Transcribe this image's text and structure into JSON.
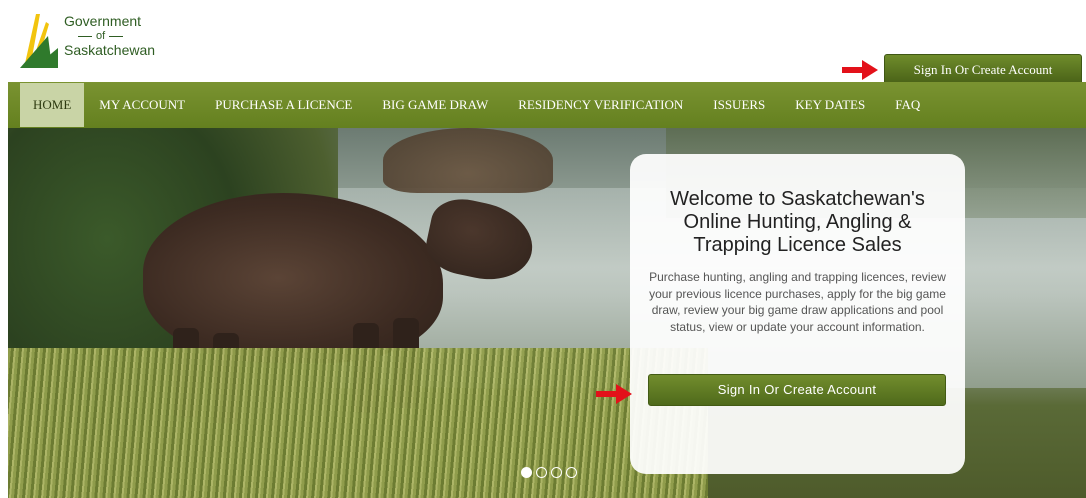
{
  "brand": {
    "line1": "Government",
    "line2": "of",
    "line3": "Saskatchewan",
    "colors": {
      "primary_green": "#6a8426",
      "logo_yellow": "#f2c40e",
      "logo_green": "#2f5d23",
      "arrow_red": "#e3111a"
    }
  },
  "header": {
    "signin_label": "Sign In Or Create Account"
  },
  "nav": {
    "items": [
      {
        "label": "HOME",
        "active": true
      },
      {
        "label": "MY ACCOUNT"
      },
      {
        "label": "PURCHASE A LICENCE"
      },
      {
        "label": "BIG GAME DRAW"
      },
      {
        "label": "RESIDENCY VERIFICATION"
      },
      {
        "label": "ISSUERS"
      },
      {
        "label": "KEY DATES"
      },
      {
        "label": "FAQ"
      }
    ]
  },
  "hero": {
    "title": "Welcome to Saskatchewan's Online Hunting, Angling & Trapping Licence Sales",
    "description": "Purchase hunting, angling and trapping licences, review your previous licence purchases, apply for the big game draw, review your big game draw applications and pool status, view or update your account information.",
    "signin_label": "Sign In Or Create Account",
    "slides": {
      "total": 4,
      "active": 1
    }
  }
}
